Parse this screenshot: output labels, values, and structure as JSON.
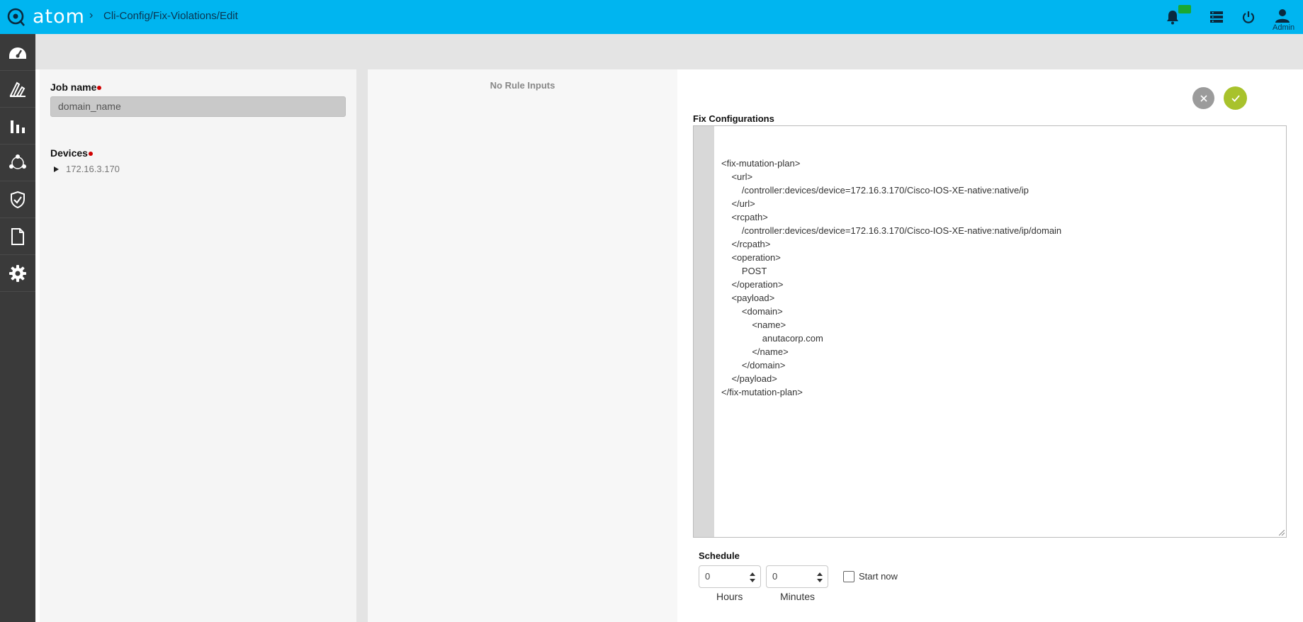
{
  "app": {
    "logo_text": "atom",
    "breadcrumb_separator": "›",
    "breadcrumb": "Cli-Config/Fix-Violations/Edit"
  },
  "header": {
    "user_label": "Admin"
  },
  "sidebar": {
    "items": [
      {
        "icon": "dashboard-icon"
      },
      {
        "icon": "resources-icon"
      },
      {
        "icon": "charts-icon"
      },
      {
        "icon": "topology-icon"
      },
      {
        "icon": "compliance-shield-icon"
      },
      {
        "icon": "document-icon"
      },
      {
        "icon": "settings-gear-icon"
      }
    ]
  },
  "form": {
    "job_name_label": "Job name",
    "job_name_value": "domain_name",
    "devices_label": "Devices",
    "device": "172.16.3.170"
  },
  "middle": {
    "no_rule_inputs": "No Rule Inputs"
  },
  "fix": {
    "label": "Fix Configurations",
    "code": "<fix-mutation-plan>\n    <url>\n        /controller:devices/device=172.16.3.170/Cisco-IOS-XE-native:native/ip\n    </url>\n    <rcpath>\n        /controller:devices/device=172.16.3.170/Cisco-IOS-XE-native:native/ip/domain\n    </rcpath>\n    <operation>\n        POST\n    </operation>\n    <payload>\n        <domain>\n            <name>\n                anutacorp.com\n            </name>\n        </domain>\n    </payload>\n</fix-mutation-plan>"
  },
  "schedule": {
    "label": "Schedule",
    "hours_value": "0",
    "minutes_value": "0",
    "hours_label": "Hours",
    "minutes_label": "Minutes",
    "start_now_label": "Start now"
  },
  "colors": {
    "header": "#00b5f0",
    "sidebar": "#3a3a3a",
    "confirm": "#a8c22c",
    "cancel": "#9b9b9b",
    "required": "#d00000"
  }
}
